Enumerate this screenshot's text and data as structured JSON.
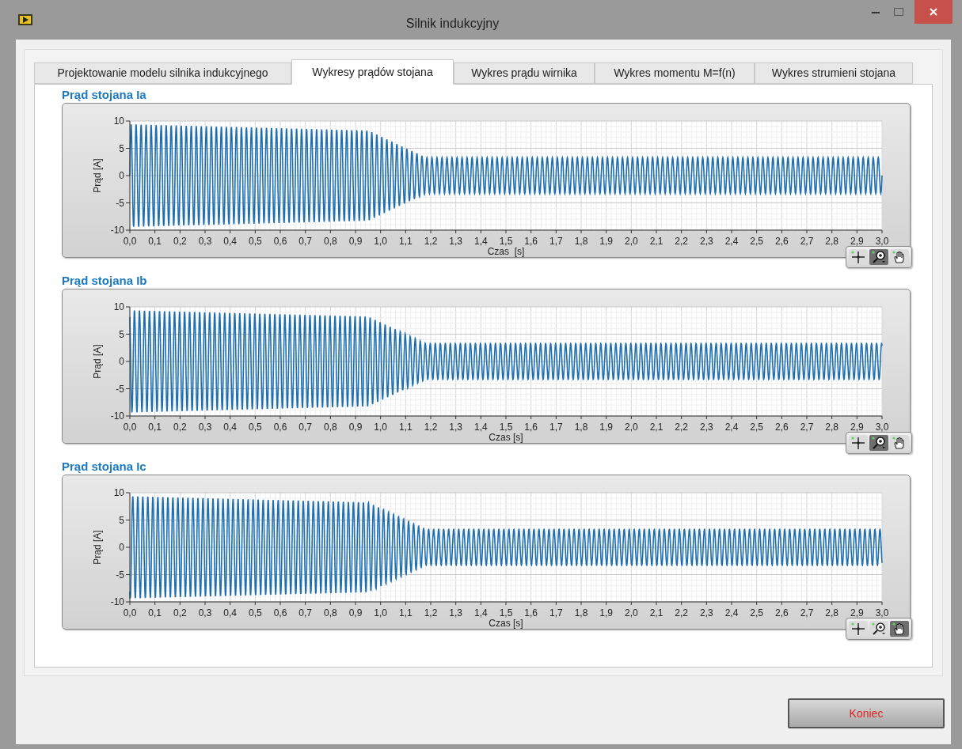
{
  "window": {
    "title": "Silnik indukcyjny"
  },
  "tabs": [
    {
      "label": "Projektowanie modelu silnika indukcyjnego",
      "selected": false
    },
    {
      "label": "Wykresy prądów stojana",
      "selected": true
    },
    {
      "label": "Wykres prądu wirnika",
      "selected": false
    },
    {
      "label": "Wykres momentu M=f(n)",
      "selected": false
    },
    {
      "label": "Wykres strumieni stojana",
      "selected": false
    }
  ],
  "graphs": [
    {
      "title": "Prąd stojana Ia",
      "ylabel": "Prąd [A]",
      "xlabel": "Czas  [s]",
      "yticks": [
        "10",
        "5",
        "0",
        "-5",
        "-10"
      ],
      "xticks": [
        "0,0",
        "0,1",
        "0,2",
        "0,3",
        "0,4",
        "0,5",
        "0,6",
        "0,7",
        "0,8",
        "0,9",
        "1,0",
        "1,1",
        "1,2",
        "1,3",
        "1,4",
        "1,5",
        "1,6",
        "1,7",
        "1,8",
        "1,9",
        "2,0",
        "2,1",
        "2,2",
        "2,3",
        "2,4",
        "2,5",
        "2,6",
        "2,7",
        "2,8",
        "2,9",
        "3,0"
      ],
      "tools": [
        {
          "kind": "cursor",
          "selected": false
        },
        {
          "kind": "zoom",
          "selected": true
        },
        {
          "kind": "pan",
          "selected": false
        }
      ]
    },
    {
      "title": "Prąd stojana Ib",
      "ylabel": "Prąd [A]",
      "xlabel": "Czas [s]",
      "yticks": [
        "10",
        "5",
        "0",
        "-5",
        "-10"
      ],
      "xticks": [
        "0,0",
        "0,1",
        "0,2",
        "0,3",
        "0,4",
        "0,5",
        "0,6",
        "0,7",
        "0,8",
        "0,9",
        "1,0",
        "1,1",
        "1,2",
        "1,3",
        "1,4",
        "1,5",
        "1,6",
        "1,7",
        "1,8",
        "1,9",
        "2,0",
        "2,1",
        "2,2",
        "2,3",
        "2,4",
        "2,5",
        "2,6",
        "2,7",
        "2,8",
        "2,9",
        "3,0"
      ],
      "tools": [
        {
          "kind": "cursor",
          "selected": false
        },
        {
          "kind": "zoom",
          "selected": true
        },
        {
          "kind": "pan",
          "selected": false
        }
      ]
    },
    {
      "title": "Prąd stojana Ic",
      "ylabel": "Prąd [A]",
      "xlabel": "Czas [s]",
      "yticks": [
        "10",
        "5",
        "0",
        "-5",
        "-10"
      ],
      "xticks": [
        "0,0",
        "0,1",
        "0,2",
        "0,3",
        "0,4",
        "0,5",
        "0,6",
        "0,7",
        "0,8",
        "0,9",
        "1,0",
        "1,1",
        "1,2",
        "1,3",
        "1,4",
        "1,5",
        "1,6",
        "1,7",
        "1,8",
        "1,9",
        "2,0",
        "2,1",
        "2,2",
        "2,3",
        "2,4",
        "2,5",
        "2,6",
        "2,7",
        "2,8",
        "2,9",
        "3,0"
      ],
      "tools": [
        {
          "kind": "cursor",
          "selected": false
        },
        {
          "kind": "zoom",
          "selected": false
        },
        {
          "kind": "pan",
          "selected": true
        }
      ]
    }
  ],
  "buttons": [
    {
      "label": "Koniec"
    }
  ]
}
